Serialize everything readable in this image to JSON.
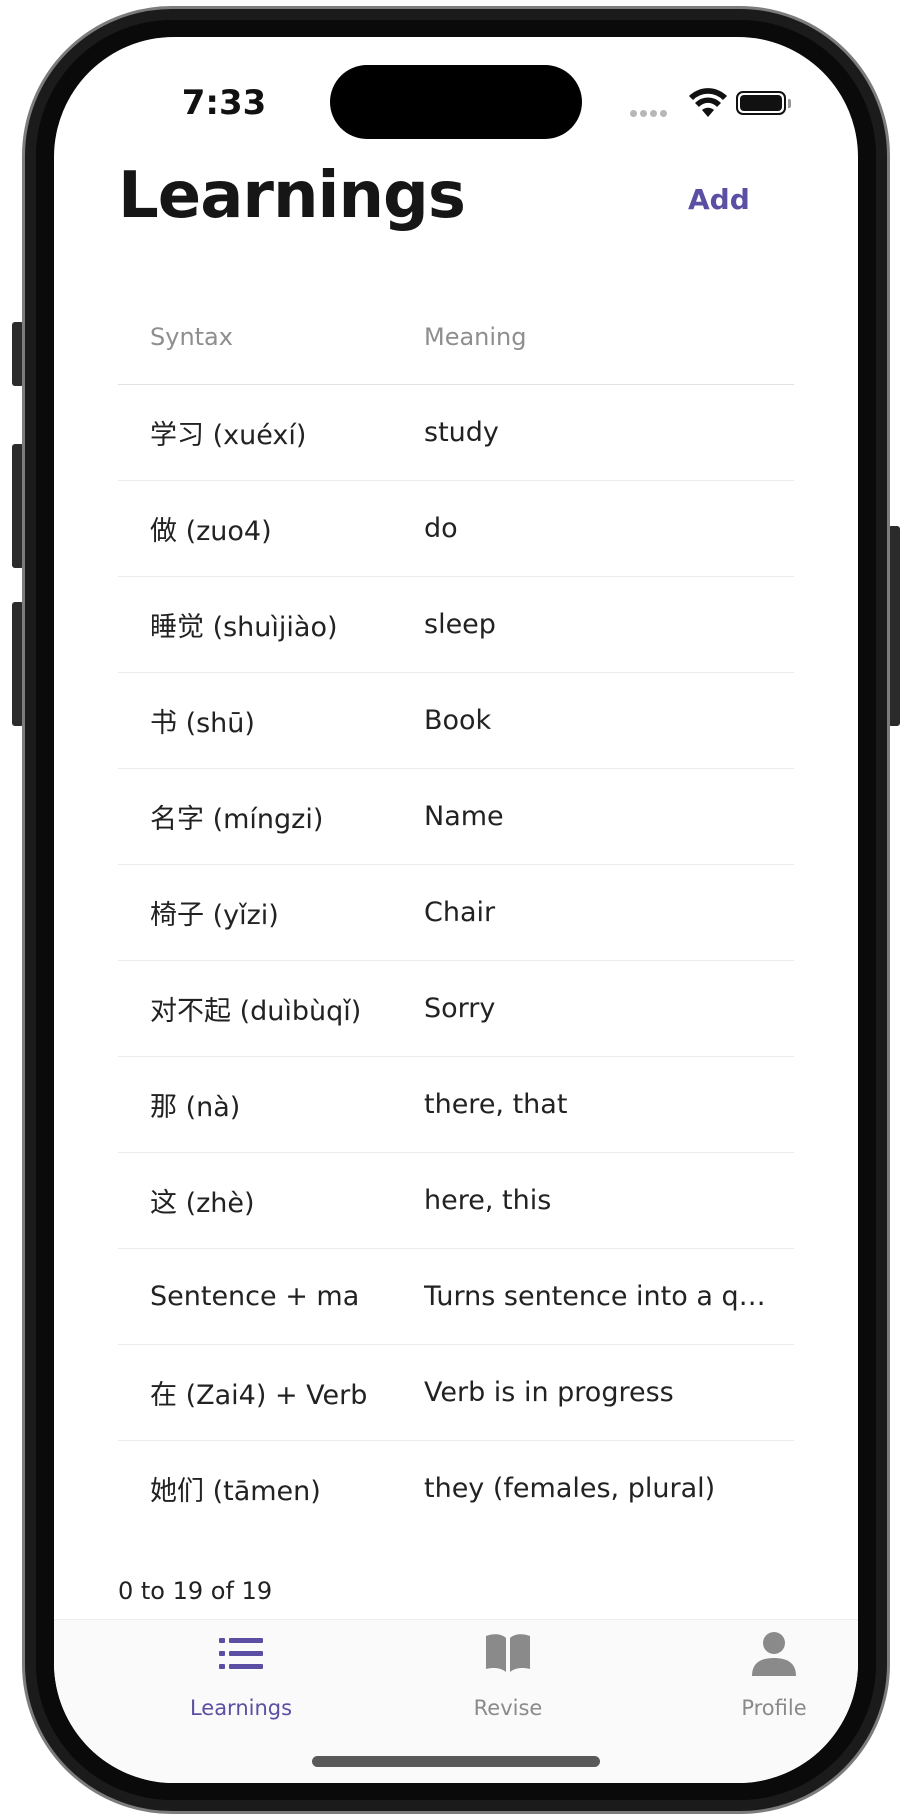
{
  "status_bar": {
    "time": "7:33"
  },
  "header": {
    "title": "Learnings",
    "add_label": "Add"
  },
  "table": {
    "columns": [
      "Syntax",
      "Meaning"
    ],
    "rows": [
      {
        "syntax": "学习 (xuéxí)",
        "meaning": "study"
      },
      {
        "syntax": "做 (zuo4)",
        "meaning": "do"
      },
      {
        "syntax": "睡觉 (shuìjiào)",
        "meaning": "sleep"
      },
      {
        "syntax": "书 (shū)",
        "meaning": "Book"
      },
      {
        "syntax": "名字 (míngzi)",
        "meaning": "Name"
      },
      {
        "syntax": "椅子 (yǐzi)",
        "meaning": "Chair"
      },
      {
        "syntax": "对不起 (duìbùqǐ)",
        "meaning": "Sorry"
      },
      {
        "syntax": "那 (nà)",
        "meaning": "there, that"
      },
      {
        "syntax": "这 (zhè)",
        "meaning": "here, this"
      },
      {
        "syntax": "Sentence + ma",
        "meaning": "Turns sentence into a question"
      },
      {
        "syntax": "在 (Zai4) + Verb",
        "meaning": "Verb is in progress"
      },
      {
        "syntax": "她们 (tāmen)",
        "meaning": "they (females, plural)"
      }
    ]
  },
  "pagination": {
    "text": "0 to 19 of 19"
  },
  "tabs": [
    {
      "label": "Learnings",
      "icon": "list-icon",
      "active": true
    },
    {
      "label": "Revise",
      "icon": "book-icon",
      "active": false
    },
    {
      "label": "Profile",
      "icon": "person-icon",
      "active": false
    }
  ],
  "colors": {
    "accent": "#5a4fa3",
    "inactive": "#8a8a8a",
    "text": "#222222"
  }
}
